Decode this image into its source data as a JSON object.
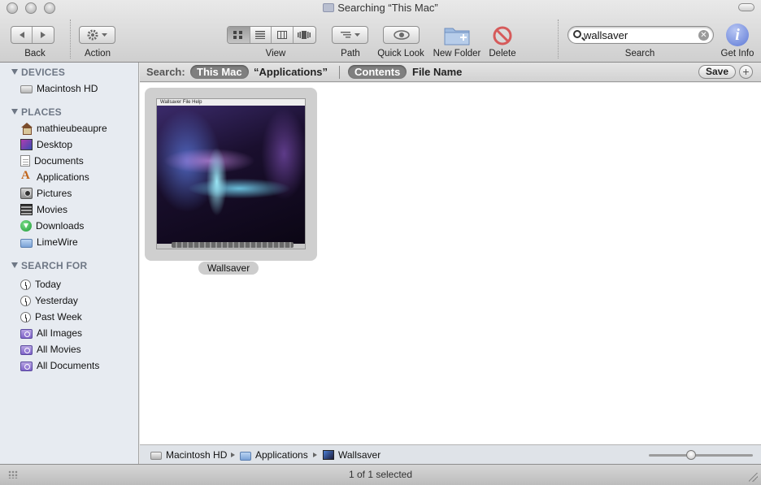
{
  "window": {
    "title": "Searching “This Mac”"
  },
  "toolbar": {
    "back_label": "Back",
    "action_label": "Action",
    "view_label": "View",
    "path_label": "Path",
    "quicklook_label": "Quick Look",
    "newfolder_label": "New Folder",
    "delete_label": "Delete",
    "search_label": "Search",
    "getinfo_label": "Get Info",
    "search_value": "wallsaver"
  },
  "sidebar": {
    "devices": {
      "heading": "DEVICES",
      "items": [
        {
          "label": "Macintosh HD",
          "icon": "hard-drive-icon"
        }
      ]
    },
    "places": {
      "heading": "PLACES",
      "items": [
        {
          "label": "mathieubeaupre",
          "icon": "home-icon"
        },
        {
          "label": "Desktop",
          "icon": "desktop-icon"
        },
        {
          "label": "Documents",
          "icon": "documents-icon"
        },
        {
          "label": "Applications",
          "icon": "applications-icon"
        },
        {
          "label": "Pictures",
          "icon": "pictures-icon"
        },
        {
          "label": "Movies",
          "icon": "movies-icon"
        },
        {
          "label": "Downloads",
          "icon": "downloads-icon"
        },
        {
          "label": "LimeWire",
          "icon": "folder-icon"
        }
      ]
    },
    "search_for": {
      "heading": "SEARCH FOR",
      "items": [
        {
          "label": "Today",
          "icon": "clock-icon"
        },
        {
          "label": "Yesterday",
          "icon": "clock-icon"
        },
        {
          "label": "Past Week",
          "icon": "clock-icon"
        },
        {
          "label": "All Images",
          "icon": "smart-folder-icon"
        },
        {
          "label": "All Movies",
          "icon": "smart-folder-icon"
        },
        {
          "label": "All Documents",
          "icon": "smart-folder-icon"
        }
      ]
    }
  },
  "scopebar": {
    "label": "Search:",
    "this_mac": "This Mac",
    "applications": "“Applications”",
    "contents": "Contents",
    "file_name": "File Name",
    "save": "Save",
    "plus": "+"
  },
  "content": {
    "items": [
      {
        "name": "Wallsaver",
        "thumb_menu": "Wallsaver   File   Help"
      }
    ]
  },
  "pathbar": {
    "crumbs": [
      "Macintosh HD",
      "Applications",
      "Wallsaver"
    ],
    "icon_size_level": 0.4
  },
  "status": {
    "text": "1 of 1 selected"
  }
}
